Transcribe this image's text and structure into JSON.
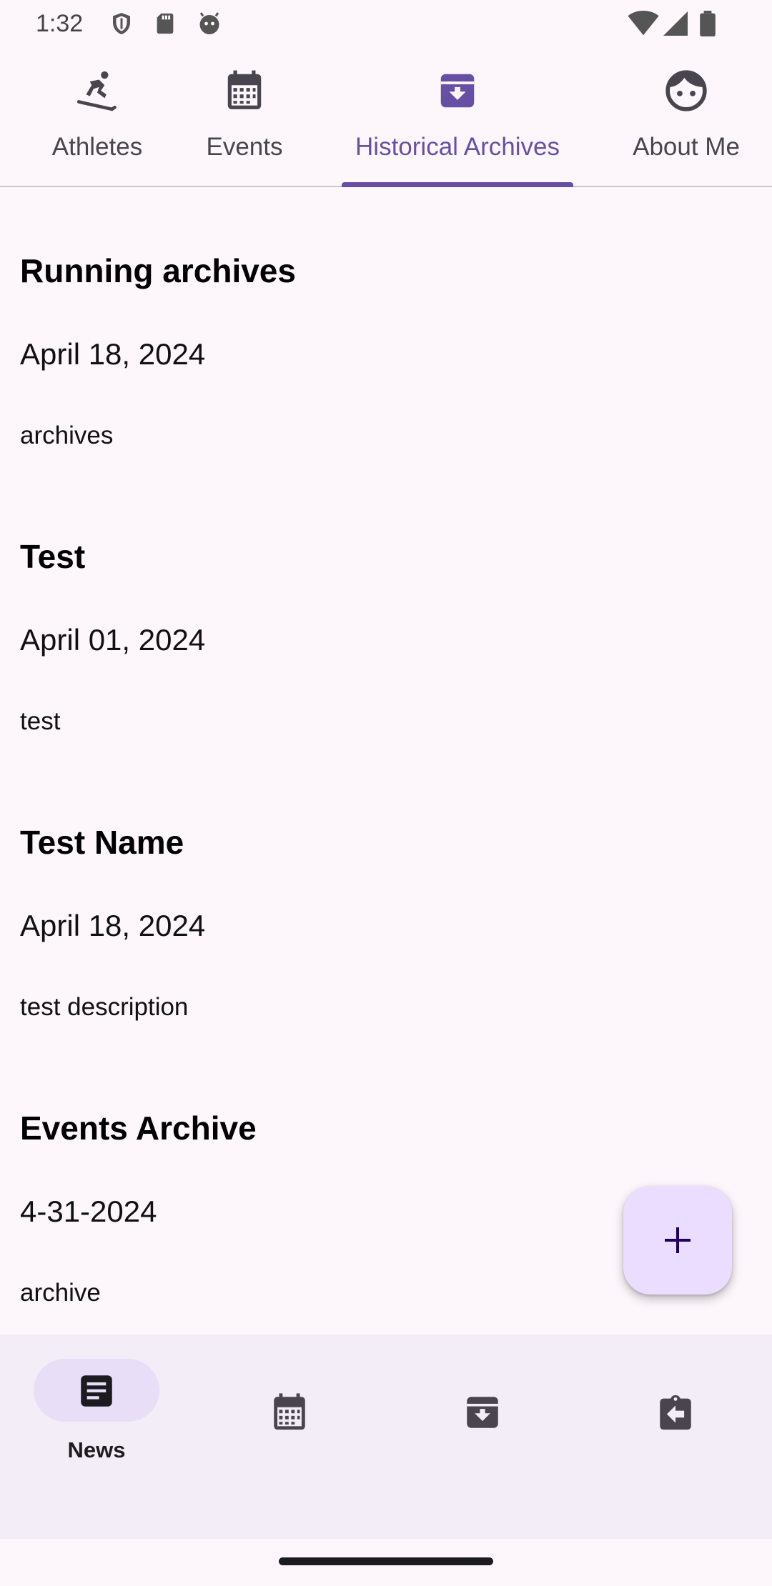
{
  "status_bar": {
    "time": "1:32"
  },
  "tabs": [
    {
      "label": "Athletes",
      "icon": "skiing-icon",
      "active": false
    },
    {
      "label": "Events",
      "icon": "calendar-icon",
      "active": false
    },
    {
      "label": "Historical Archives",
      "icon": "archive-icon",
      "active": true
    },
    {
      "label": "About Me",
      "icon": "face-icon",
      "active": false
    }
  ],
  "archives": [
    {
      "title": "Running archives",
      "date": "April 18, 2024",
      "description": "archives"
    },
    {
      "title": "Test",
      "date": "April 01, 2024",
      "description": "test"
    },
    {
      "title": "Test Name",
      "date": "April 18, 2024",
      "description": "test description"
    },
    {
      "title": "Events Archive",
      "date": "4-31-2024",
      "description": "archive"
    }
  ],
  "fab": {
    "icon": "plus-icon"
  },
  "bottom_nav": [
    {
      "label": "News",
      "icon": "article-icon",
      "active": true
    },
    {
      "label": "",
      "icon": "calendar-icon",
      "active": false
    },
    {
      "label": "",
      "icon": "archive-icon",
      "active": false
    },
    {
      "label": "",
      "icon": "assignment-return-icon",
      "active": false
    }
  ],
  "colors": {
    "accent": "#6750a4",
    "background": "#fdf7fc",
    "fab_container": "#eaddff",
    "nav_background": "#f3edf7",
    "nav_pill": "#e8def8"
  }
}
